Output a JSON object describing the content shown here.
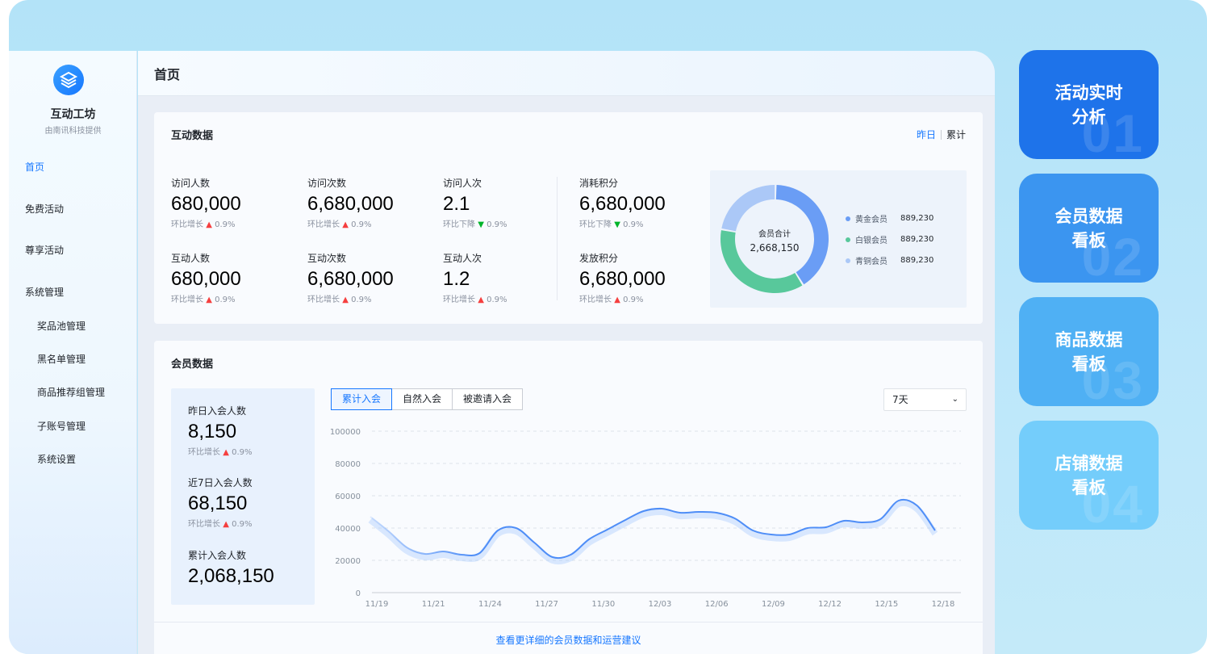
{
  "sidebar": {
    "brand_name": "互动工坊",
    "brand_sub": "由南讯科技提供",
    "items": [
      {
        "label": "首页",
        "active": true
      },
      {
        "label": "免费活动"
      },
      {
        "label": "尊享活动"
      },
      {
        "label": "系统管理"
      }
    ],
    "sub_items": [
      "奖品池管理",
      "黑名单管理",
      "商品推荐组管理",
      "子账号管理",
      "系统设置"
    ]
  },
  "header": {
    "title": "首页"
  },
  "interaction": {
    "title": "互动数据",
    "toggle": {
      "active": "昨日",
      "inactive": "累计"
    },
    "metrics": [
      {
        "label": "访问人数",
        "value": "680,000",
        "trend_label": "环比增长",
        "dir": "up",
        "symbol": "▲",
        "pct": "0.9%"
      },
      {
        "label": "访问次数",
        "value": "6,680,000",
        "trend_label": "环比增长",
        "dir": "up",
        "symbol": "▲",
        "pct": "0.9%"
      },
      {
        "label": "访问人次",
        "value": "2.1",
        "trend_label": "环比下降",
        "dir": "down",
        "symbol": "▼",
        "pct": "0.9%"
      },
      {
        "label": "消耗积分",
        "value": "6,680,000",
        "trend_label": "环比下降",
        "dir": "down",
        "symbol": "▼",
        "pct": "0.9%"
      },
      {
        "label": "互动人数",
        "value": "680,000",
        "trend_label": "环比增长",
        "dir": "up",
        "symbol": "▲",
        "pct": "0.9%"
      },
      {
        "label": "互动次数",
        "value": "6,680,000",
        "trend_label": "环比增长",
        "dir": "up",
        "symbol": "▲",
        "pct": "0.9%"
      },
      {
        "label": "互动人次",
        "value": "1.2",
        "trend_label": "环比增长",
        "dir": "up",
        "symbol": "▲",
        "pct": "0.9%"
      },
      {
        "label": "发放积分",
        "value": "6,680,000",
        "trend_label": "环比增长",
        "dir": "up",
        "symbol": "▲",
        "pct": "0.9%"
      }
    ],
    "donut": {
      "center_label": "会员合计",
      "center_value": "2,668,150",
      "slices": [
        {
          "name": "黄金会员",
          "value": "889,230",
          "share": 0.4,
          "color": "#6a9df5"
        },
        {
          "name": "白银会员",
          "value": "889,230",
          "share": 0.36,
          "color": "#58c89b"
        },
        {
          "name": "青铜会员",
          "value": "889,230",
          "share": 0.22,
          "color": "#abc8f7"
        }
      ]
    }
  },
  "member": {
    "title": "会员数据",
    "stats": [
      {
        "label": "昨日入会人数",
        "value": "8,150",
        "trend_label": "环比增长",
        "symbol": "▲",
        "pct": "0.9%"
      },
      {
        "label": "近7日入会人数",
        "value": "68,150",
        "trend_label": "环比增长",
        "symbol": "▲",
        "pct": "0.9%"
      },
      {
        "label": "累计入会人数",
        "value": "2,068,150"
      }
    ],
    "tabs": [
      {
        "label": "累计入会",
        "active": true
      },
      {
        "label": "自然入会"
      },
      {
        "label": "被邀请入会"
      }
    ],
    "range": "7天",
    "footer_link": "查看更详细的会员数据和运营建议"
  },
  "chart_data": {
    "type": "line",
    "ylim": [
      0,
      100000
    ],
    "yticks": [
      0,
      20000,
      40000,
      60000,
      80000,
      100000
    ],
    "xticks": [
      "11/19",
      "11/21",
      "11/24",
      "11/27",
      "11/30",
      "12/03",
      "12/06",
      "12/09",
      "12/12",
      "12/15",
      "12/18"
    ],
    "grid": true,
    "color": "#4f8ef7",
    "series": [
      {
        "values": [
          47000,
          38000,
          28000,
          24000,
          25500,
          23500,
          24500,
          38500,
          40000,
          31000,
          22000,
          23500,
          33000,
          39000,
          45000,
          50500,
          52000,
          49500,
          50000,
          49500,
          46000,
          38500,
          36000,
          36000,
          40000,
          40500,
          44500,
          43500,
          45500,
          57000,
          54000,
          38500
        ]
      }
    ]
  },
  "side_cards": [
    {
      "line1": "活动实时",
      "line2": "分析",
      "num": "01",
      "color": "#1e73ea"
    },
    {
      "line1": "会员数据",
      "line2": "看板",
      "num": "02",
      "color": "#3b95f0"
    },
    {
      "line1": "商品数据",
      "line2": "看板",
      "num": "03",
      "color": "#4fb0f4"
    },
    {
      "line1": "店铺数据",
      "line2": "看板",
      "num": "04",
      "color": "#74cdfb"
    }
  ]
}
